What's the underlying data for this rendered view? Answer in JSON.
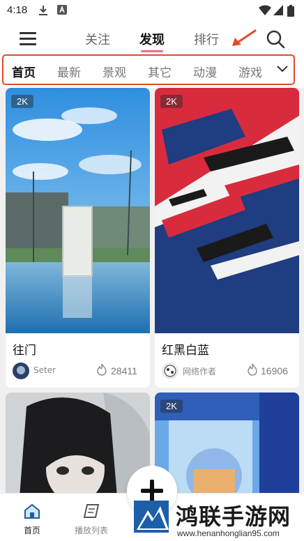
{
  "status_bar": {
    "time": "4:18"
  },
  "top_nav": {
    "tabs": [
      {
        "label": "关注",
        "active": false
      },
      {
        "label": "发现",
        "active": true
      },
      {
        "label": "排行",
        "active": false
      }
    ],
    "accent_color": "#f06a8c"
  },
  "category_bar": {
    "items": [
      {
        "label": "首页",
        "active": true
      },
      {
        "label": "最新",
        "active": false
      },
      {
        "label": "景观",
        "active": false
      },
      {
        "label": "其它",
        "active": false
      },
      {
        "label": "动漫",
        "active": false
      },
      {
        "label": "游戏",
        "active": false
      }
    ],
    "highlight_color": "#e04a2d",
    "annotation_arrow_color": "#e04a2d"
  },
  "cards": [
    {
      "badge": "2K",
      "title": "往门",
      "author": "Seter",
      "likes": "28411"
    },
    {
      "badge": "2K",
      "title": "红黑白蓝",
      "author": "网络作者",
      "likes": "16906"
    },
    {
      "badge": "",
      "title": "",
      "author": "",
      "likes": ""
    },
    {
      "badge": "2K",
      "title": "",
      "author": "",
      "likes": ""
    }
  ],
  "bottom_nav": {
    "items": [
      {
        "label": "首页",
        "active": true,
        "icon": "home-icon"
      },
      {
        "label": "播放列表",
        "active": false,
        "icon": "playlist-icon"
      }
    ],
    "fab_icon": "plus-icon"
  },
  "watermark": {
    "name": "鸿联手游网",
    "url": "www.henanhonglian95.com"
  }
}
